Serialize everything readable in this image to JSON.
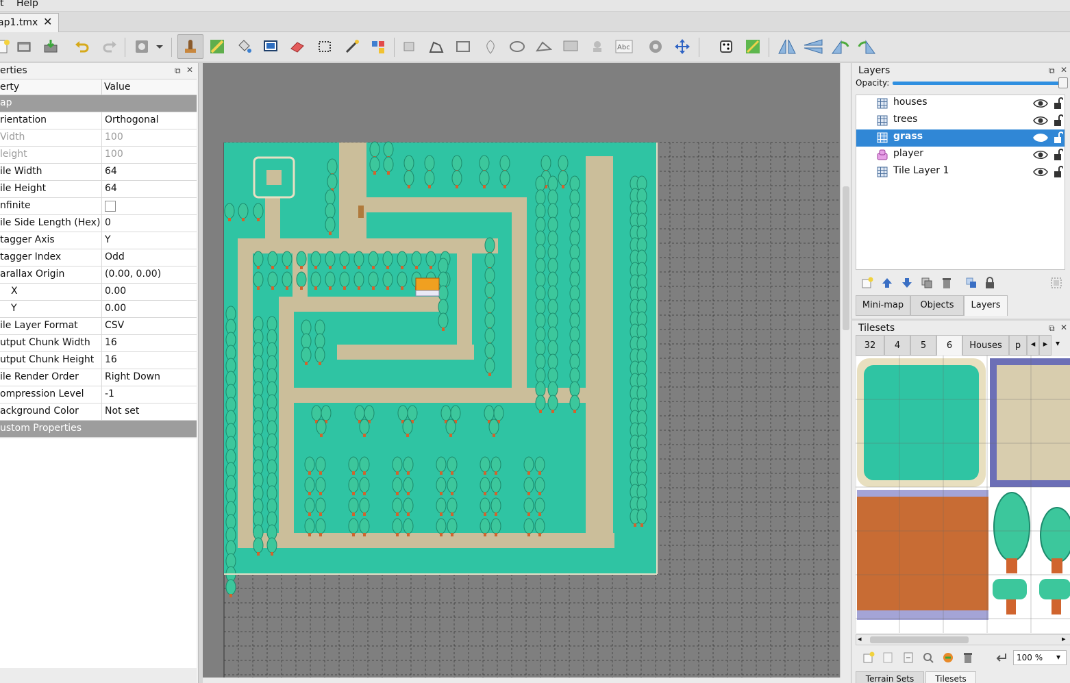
{
  "menu": {
    "items": [
      "t",
      "Help"
    ]
  },
  "document_tab": {
    "label": "ap1.tmx",
    "close": "✕"
  },
  "toolbar": {
    "icons": [
      "new-file-icon",
      "open-icon",
      "save-icon",
      "undo-icon",
      "redo-icon",
      "command-icon",
      "dropdown-arrow-icon",
      "stamp-brush-icon",
      "terrain-brush-icon",
      "bucket-fill-icon",
      "shape-fill-icon",
      "eraser-icon",
      "rect-select-icon",
      "magic-wand-icon",
      "select-same-tile-icon",
      "select-objects-icon",
      "edit-polygons-icon",
      "insert-rectangle-icon",
      "insert-point-icon",
      "insert-ellipse-icon",
      "insert-polygon-icon",
      "insert-tile-icon",
      "insert-template-icon",
      "insert-text-icon",
      "layer-offset-icon",
      "move-icon",
      "random-mode-icon",
      "wang-fill-icon",
      "flip-horizontal-icon",
      "flip-vertical-icon",
      "rotate-left-icon",
      "rotate-right-icon"
    ]
  },
  "properties": {
    "title": "erties",
    "header_property": "erty",
    "header_value": "Value",
    "rows": [
      {
        "name": "ap",
        "value": "",
        "type": "group"
      },
      {
        "name": "rientation",
        "value": "Orthogonal",
        "type": "normal"
      },
      {
        "name": "Vidth",
        "value": "100",
        "type": "disabled"
      },
      {
        "name": "leight",
        "value": "100",
        "type": "disabled"
      },
      {
        "name": "ile Width",
        "value": "64",
        "type": "normal"
      },
      {
        "name": "ile Height",
        "value": "64",
        "type": "normal"
      },
      {
        "name": "nfinite",
        "value": "",
        "type": "checkbox"
      },
      {
        "name": "ile Side Length (Hex)",
        "value": "0",
        "type": "normal"
      },
      {
        "name": "tagger Axis",
        "value": "Y",
        "type": "normal"
      },
      {
        "name": "tagger Index",
        "value": "Odd",
        "type": "normal"
      },
      {
        "name": "arallax Origin",
        "value": "(0.00, 0.00)",
        "type": "normal"
      },
      {
        "name": "X",
        "value": "0.00",
        "type": "sub"
      },
      {
        "name": "Y",
        "value": "0.00",
        "type": "sub"
      },
      {
        "name": "ile Layer Format",
        "value": "CSV",
        "type": "normal"
      },
      {
        "name": "utput Chunk Width",
        "value": "16",
        "type": "normal"
      },
      {
        "name": "utput Chunk Height",
        "value": "16",
        "type": "normal"
      },
      {
        "name": "ile Render Order",
        "value": "Right Down",
        "type": "normal"
      },
      {
        "name": "ompression Level",
        "value": "-1",
        "type": "normal"
      },
      {
        "name": "ackground Color",
        "value": "Not set",
        "type": "normal"
      },
      {
        "name": "ustom Properties",
        "value": "",
        "type": "group"
      }
    ]
  },
  "layers": {
    "title": "Layers",
    "opacity_label": "Opacity:",
    "opacity_value": 1.0,
    "items": [
      {
        "name": "houses",
        "kind": "tile-layer-icon",
        "selected": false
      },
      {
        "name": "trees",
        "kind": "tile-layer-icon",
        "selected": false
      },
      {
        "name": "grass",
        "kind": "tile-layer-icon",
        "selected": true
      },
      {
        "name": "player",
        "kind": "object-layer-icon",
        "selected": false
      },
      {
        "name": "Tile Layer 1",
        "kind": "tile-layer-icon",
        "selected": false
      }
    ],
    "tabs": [
      "Mini-map",
      "Objects",
      "Layers"
    ],
    "active_tab": "Layers"
  },
  "tilesets": {
    "title": "Tilesets",
    "tabs": [
      "32",
      "4",
      "5",
      "6",
      "Houses",
      "p"
    ],
    "active_tab": "6",
    "zoom": "100 %",
    "bottom_tabs": [
      "Terrain Sets",
      "Tilesets"
    ]
  },
  "colors": {
    "grass": "#2fc4a3",
    "path": "#cbbe9a",
    "canvas_bg": "#7f7f7f",
    "selection": "#3087d6",
    "tree": "#3cc79c",
    "trunk": "#d0642e"
  }
}
